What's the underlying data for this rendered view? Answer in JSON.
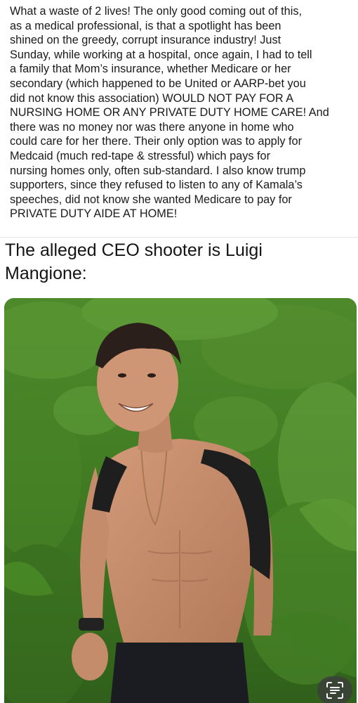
{
  "post": {
    "text": "What a waste of 2 lives! The only good coming out of this,\nas a medical professional, is that a spotlight has been\nshined on the greedy, corrupt insurance industry! Just\nSunday, while working at a hospital, once again, I had to tell\na family that Mom’s insurance, whether Medicare or her\nsecondary (which happened to be United or AARP-bet you\ndid not know this association) WOULD NOT PAY FOR A\nNURSING HOME OR ANY PRIVATE DUTY HOME CARE! And\nthere was no money nor was there anyone in home who\ncould care for her there. Their only option was to apply for\nMedcaid (much red-tape & stressful) which pays for\nnursing homes only, often sub-standard. I also know trump\nsupporters, since they refused to listen to any of Kamala’s\nspeeches, did not know she wanted Medicare to pay for\nPRIVATE DUTY AIDE AT HOME!"
  },
  "headline": {
    "text": "The alleged CEO shooter is Luigi\nMangione:"
  },
  "photo": {
    "icon": "person-photo"
  },
  "scan_button": {
    "icon": "live-text-scan-icon"
  },
  "colors": {
    "foliage": "#3f7a22",
    "skin": "#c88f6e",
    "backpack": "#1e1e1e",
    "text": "#1a1a1a"
  }
}
